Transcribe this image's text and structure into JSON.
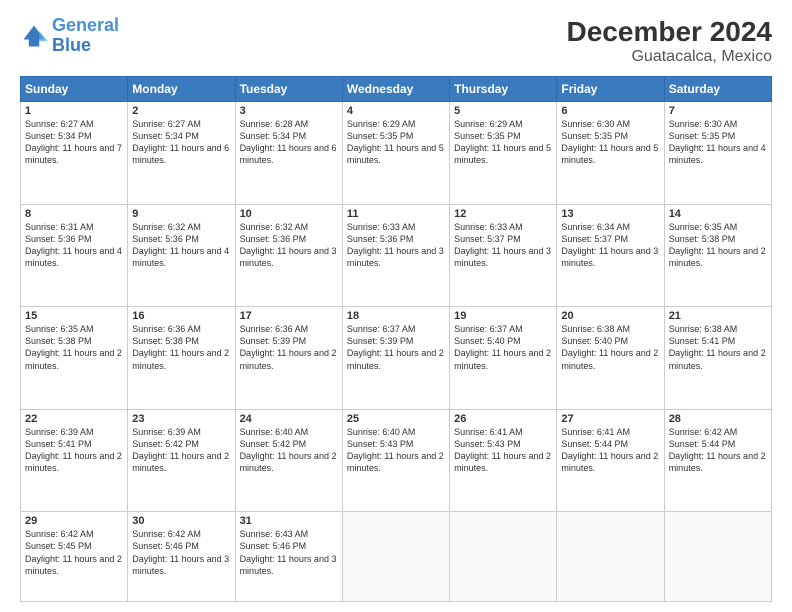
{
  "logo": {
    "line1": "General",
    "line2": "Blue"
  },
  "title": "December 2024",
  "subtitle": "Guatacalca, Mexico",
  "weekdays": [
    "Sunday",
    "Monday",
    "Tuesday",
    "Wednesday",
    "Thursday",
    "Friday",
    "Saturday"
  ],
  "days": [
    {
      "date": "1",
      "col": 0,
      "sunrise": "6:27 AM",
      "sunset": "5:34 PM",
      "daylight": "11 hours and 7 minutes."
    },
    {
      "date": "2",
      "col": 1,
      "sunrise": "6:27 AM",
      "sunset": "5:34 PM",
      "daylight": "11 hours and 6 minutes."
    },
    {
      "date": "3",
      "col": 2,
      "sunrise": "6:28 AM",
      "sunset": "5:34 PM",
      "daylight": "11 hours and 6 minutes."
    },
    {
      "date": "4",
      "col": 3,
      "sunrise": "6:29 AM",
      "sunset": "5:35 PM",
      "daylight": "11 hours and 5 minutes."
    },
    {
      "date": "5",
      "col": 4,
      "sunrise": "6:29 AM",
      "sunset": "5:35 PM",
      "daylight": "11 hours and 5 minutes."
    },
    {
      "date": "6",
      "col": 5,
      "sunrise": "6:30 AM",
      "sunset": "5:35 PM",
      "daylight": "11 hours and 5 minutes."
    },
    {
      "date": "7",
      "col": 6,
      "sunrise": "6:30 AM",
      "sunset": "5:35 PM",
      "daylight": "11 hours and 4 minutes."
    },
    {
      "date": "8",
      "col": 0,
      "sunrise": "6:31 AM",
      "sunset": "5:36 PM",
      "daylight": "11 hours and 4 minutes."
    },
    {
      "date": "9",
      "col": 1,
      "sunrise": "6:32 AM",
      "sunset": "5:36 PM",
      "daylight": "11 hours and 4 minutes."
    },
    {
      "date": "10",
      "col": 2,
      "sunrise": "6:32 AM",
      "sunset": "5:36 PM",
      "daylight": "11 hours and 3 minutes."
    },
    {
      "date": "11",
      "col": 3,
      "sunrise": "6:33 AM",
      "sunset": "5:36 PM",
      "daylight": "11 hours and 3 minutes."
    },
    {
      "date": "12",
      "col": 4,
      "sunrise": "6:33 AM",
      "sunset": "5:37 PM",
      "daylight": "11 hours and 3 minutes."
    },
    {
      "date": "13",
      "col": 5,
      "sunrise": "6:34 AM",
      "sunset": "5:37 PM",
      "daylight": "11 hours and 3 minutes."
    },
    {
      "date": "14",
      "col": 6,
      "sunrise": "6:35 AM",
      "sunset": "5:38 PM",
      "daylight": "11 hours and 2 minutes."
    },
    {
      "date": "15",
      "col": 0,
      "sunrise": "6:35 AM",
      "sunset": "5:38 PM",
      "daylight": "11 hours and 2 minutes."
    },
    {
      "date": "16",
      "col": 1,
      "sunrise": "6:36 AM",
      "sunset": "5:38 PM",
      "daylight": "11 hours and 2 minutes."
    },
    {
      "date": "17",
      "col": 2,
      "sunrise": "6:36 AM",
      "sunset": "5:39 PM",
      "daylight": "11 hours and 2 minutes."
    },
    {
      "date": "18",
      "col": 3,
      "sunrise": "6:37 AM",
      "sunset": "5:39 PM",
      "daylight": "11 hours and 2 minutes."
    },
    {
      "date": "19",
      "col": 4,
      "sunrise": "6:37 AM",
      "sunset": "5:40 PM",
      "daylight": "11 hours and 2 minutes."
    },
    {
      "date": "20",
      "col": 5,
      "sunrise": "6:38 AM",
      "sunset": "5:40 PM",
      "daylight": "11 hours and 2 minutes."
    },
    {
      "date": "21",
      "col": 6,
      "sunrise": "6:38 AM",
      "sunset": "5:41 PM",
      "daylight": "11 hours and 2 minutes."
    },
    {
      "date": "22",
      "col": 0,
      "sunrise": "6:39 AM",
      "sunset": "5:41 PM",
      "daylight": "11 hours and 2 minutes."
    },
    {
      "date": "23",
      "col": 1,
      "sunrise": "6:39 AM",
      "sunset": "5:42 PM",
      "daylight": "11 hours and 2 minutes."
    },
    {
      "date": "24",
      "col": 2,
      "sunrise": "6:40 AM",
      "sunset": "5:42 PM",
      "daylight": "11 hours and 2 minutes."
    },
    {
      "date": "25",
      "col": 3,
      "sunrise": "6:40 AM",
      "sunset": "5:43 PM",
      "daylight": "11 hours and 2 minutes."
    },
    {
      "date": "26",
      "col": 4,
      "sunrise": "6:41 AM",
      "sunset": "5:43 PM",
      "daylight": "11 hours and 2 minutes."
    },
    {
      "date": "27",
      "col": 5,
      "sunrise": "6:41 AM",
      "sunset": "5:44 PM",
      "daylight": "11 hours and 2 minutes."
    },
    {
      "date": "28",
      "col": 6,
      "sunrise": "6:42 AM",
      "sunset": "5:44 PM",
      "daylight": "11 hours and 2 minutes."
    },
    {
      "date": "29",
      "col": 0,
      "sunrise": "6:42 AM",
      "sunset": "5:45 PM",
      "daylight": "11 hours and 2 minutes."
    },
    {
      "date": "30",
      "col": 1,
      "sunrise": "6:42 AM",
      "sunset": "5:46 PM",
      "daylight": "11 hours and 3 minutes."
    },
    {
      "date": "31",
      "col": 2,
      "sunrise": "6:43 AM",
      "sunset": "5:46 PM",
      "daylight": "11 hours and 3 minutes."
    }
  ],
  "labels": {
    "sunrise": "Sunrise:",
    "sunset": "Sunset:",
    "daylight": "Daylight:"
  }
}
